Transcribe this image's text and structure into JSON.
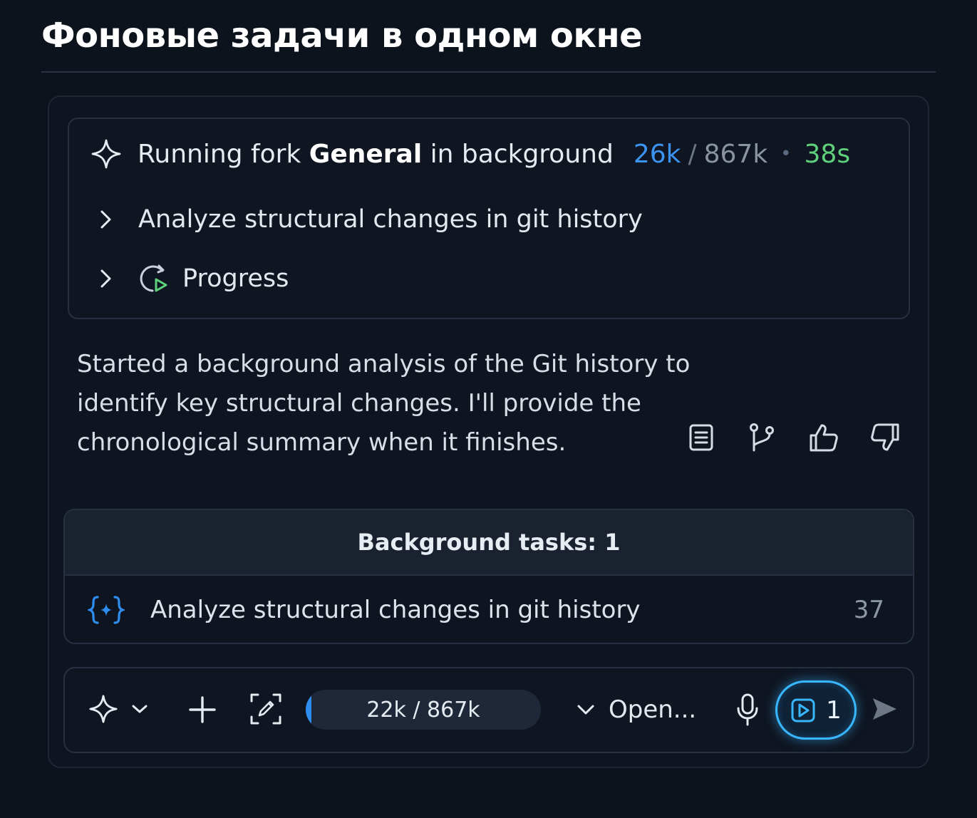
{
  "page": {
    "title": "Фоновые задачи в одном окне"
  },
  "fork": {
    "prefix": "Running fork",
    "agent": "General",
    "suffix": "in background",
    "tokens_used": "26k",
    "tokens_sep": "/",
    "tokens_total": "867k",
    "separator": "•",
    "elapsed": "38s",
    "icon": "sparkle-icon",
    "items": [
      {
        "label": "Analyze structural changes in git history",
        "icon": "chevron-right-icon"
      },
      {
        "label": "Progress",
        "icon": "progress-play-icon"
      }
    ]
  },
  "message": {
    "text": "Started a background analysis of the Git history to identify key structural changes. I'll provide the chronological summary when it finishes.",
    "actions": [
      "copy-icon",
      "branch-icon",
      "thumbs-up-icon",
      "thumbs-down-icon"
    ]
  },
  "background_tasks": {
    "header": "Background tasks: 1",
    "items": [
      {
        "name": "Analyze structural changes in git history",
        "count": "37",
        "icon": "code-braces-icon"
      }
    ]
  },
  "composer": {
    "context_label": "22k / 867k",
    "context_fraction": 0.025,
    "model_label": "Open...",
    "bg_tasks_count": "1",
    "colors": {
      "accent": "#38b6ff",
      "progress": "#2f8df0",
      "elapsed": "#5fd17c",
      "tokens": "#3b93f2"
    }
  }
}
